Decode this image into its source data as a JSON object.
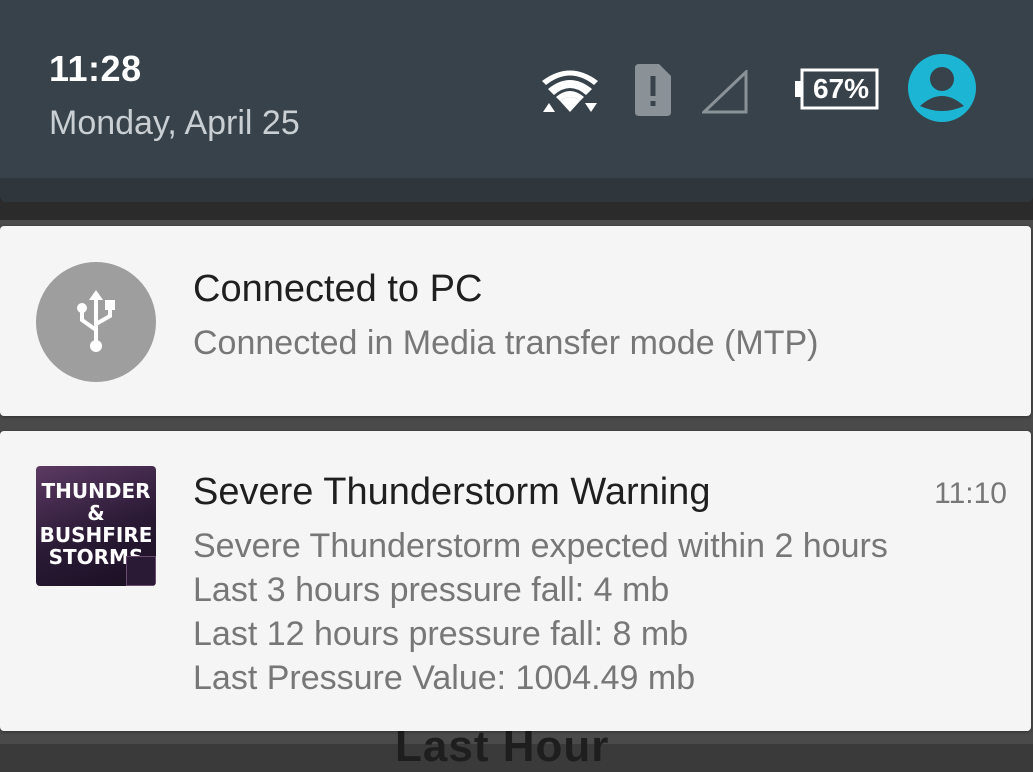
{
  "status_bar": {
    "time": "11:28",
    "date": "Monday, April 25",
    "battery_percent": "67%",
    "icons": [
      "wifi-icon",
      "sim-alert-icon",
      "cell-signal-icon",
      "battery-icon",
      "user-avatar-icon"
    ]
  },
  "notifications": [
    {
      "icon": "usb-icon",
      "title": "Connected to PC",
      "text": "Connected in Media transfer mode (MTP)"
    },
    {
      "icon": "app-logo",
      "app_logo_text": "THUNDER & BUSHFIRE STORMS",
      "title": "Severe Thunderstorm Warning",
      "time": "11:10",
      "lines": [
        "Severe Thunderstorm expected within 2 hours",
        "Last 3 hours pressure fall: 4 mb",
        "Last 12 hours pressure fall: 8 mb",
        "Last Pressure Value: 1004.49 mb"
      ]
    }
  ],
  "background_app": {
    "partial_text": "Last Hour"
  },
  "colors": {
    "header_bg": "#37424a",
    "card_bg": "#f5f5f5",
    "avatar_accent": "#1cb6d4",
    "usb_circle": "#9e9e9e"
  }
}
